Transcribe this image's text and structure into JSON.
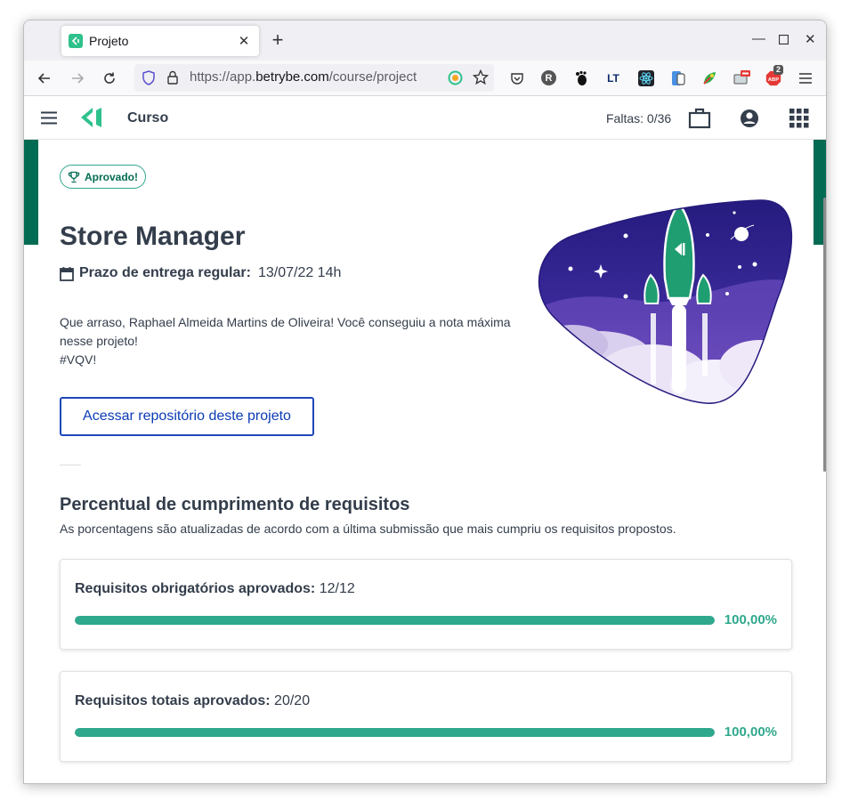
{
  "browser": {
    "tab_title": "Projeto",
    "url_prefix": "https://app.",
    "url_domain": "betrybe.com",
    "url_path": "/course/project",
    "abp_count": "2"
  },
  "header": {
    "course_label": "Curso",
    "absences": "Faltas: 0/36"
  },
  "project": {
    "badge": "Aprovado!",
    "title": "Store Manager",
    "deadline_label": "Prazo de entrega regular:",
    "deadline_value": "13/07/22 14h",
    "message_line1": "Que arraso, Raphael Almeida Martins de Oliveira! Você conseguiu a nota máxima",
    "message_line2": "nesse projeto!",
    "message_line3": "#VQV!",
    "repo_button": "Acessar repositório deste projeto"
  },
  "requirements": {
    "heading": "Percentual de cumprimento de requisitos",
    "subtitle": "As porcentagens são atualizadas de acordo com a última submissão que mais cumpriu os requisitos propostos.",
    "items": [
      {
        "label": "Requisitos obrigatórios aprovados:",
        "value": "12/12",
        "percent_text": "100,00%",
        "fraction": 1.0
      },
      {
        "label": "Requisitos totais aprovados:",
        "value": "20/20",
        "percent_text": "100,00%",
        "fraction": 1.0
      }
    ]
  },
  "colors": {
    "brand_green": "#036b52",
    "accent_green": "#2fa88d",
    "link_blue": "#0b3bb5"
  }
}
